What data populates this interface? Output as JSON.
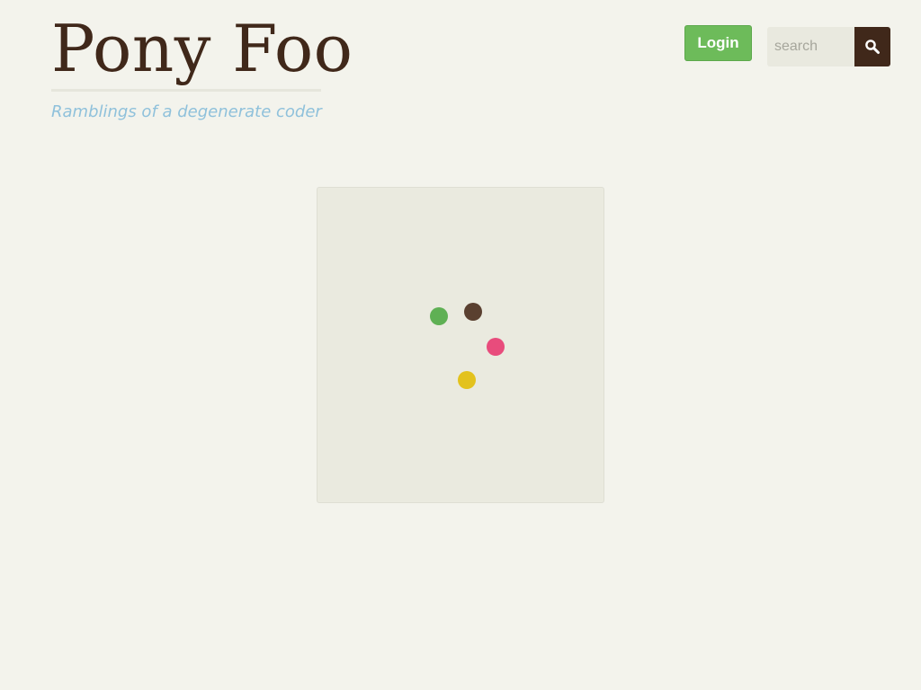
{
  "site": {
    "title": "Pony Foo",
    "tagline": "Ramblings of a degenerate coder"
  },
  "header": {
    "login_label": "Login",
    "search": {
      "placeholder": "search",
      "value": "",
      "icon": "magnifier-icon"
    }
  },
  "loader": {
    "dots": [
      {
        "name": "green-dot",
        "color": "#5fb054"
      },
      {
        "name": "brown-dot",
        "color": "#5a4030"
      },
      {
        "name": "pink-dot",
        "color": "#e84c7c"
      },
      {
        "name": "yellow-dot",
        "color": "#e3c21d"
      }
    ]
  },
  "colors": {
    "background": "#f3f3ec",
    "brand": "#40281a",
    "tagline": "#8fc1db",
    "login": "#6dbb5a",
    "panel": "#eaeadf"
  }
}
